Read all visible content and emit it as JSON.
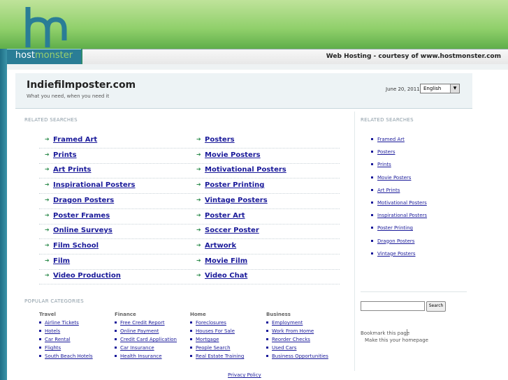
{
  "host": {
    "logo_letters": "hm",
    "logo_word_a": "host",
    "logo_word_b": "monster",
    "banner": "Web Hosting - courtesy of www.hostmonster.com"
  },
  "page": {
    "title": "Indiefilmposter.com",
    "subtitle": "What you need, when you need it",
    "date": "June 20, 2011",
    "language": "English"
  },
  "related_label": "RELATED SEARCHES",
  "related_left": [
    "Framed Art",
    "Prints",
    "Art Prints",
    "Inspirational Posters",
    "Dragon Posters",
    "Poster Frames",
    "Online Surveys",
    "Film School",
    "Film",
    "Video Production"
  ],
  "related_right": [
    "Posters",
    "Movie Posters",
    "Motivational Posters",
    "Poster Printing",
    "Vintage Posters",
    "Poster Art",
    "Soccer Poster",
    "Artwork",
    "Movie Film",
    "Video Chat"
  ],
  "sidebar_label": "RELATED SEARCHES",
  "sidebar_links": [
    "Framed Art",
    "Posters",
    "Prints",
    "Movie Posters",
    "Art Prints",
    "Motivational Posters",
    "Inspirational Posters",
    "Poster Printing",
    "Dragon Posters",
    "Vintage Posters"
  ],
  "search_button": "Search",
  "bookmark": "Bookmark this page",
  "homepage": "Make this your homepage",
  "popular_label": "POPULAR CATEGORIES",
  "categories": [
    {
      "name": "Travel",
      "links": [
        "Airline Tickets",
        "Hotels",
        "Car Rental",
        "Flights",
        "South Beach Hotels"
      ]
    },
    {
      "name": "Finance",
      "links": [
        "Free Credit Report",
        "Online Payment",
        "Credit Card Application",
        "Car Insurance",
        "Health Insurance"
      ]
    },
    {
      "name": "Home",
      "links": [
        "Foreclosures",
        "Houses For Sale",
        "Mortgage",
        "People Search",
        "Real Estate Training"
      ]
    },
    {
      "name": "Business",
      "links": [
        "Employment",
        "Work From Home",
        "Reorder Checks",
        "Used Cars",
        "Business Opportunities"
      ]
    }
  ],
  "privacy": "Privacy Policy"
}
